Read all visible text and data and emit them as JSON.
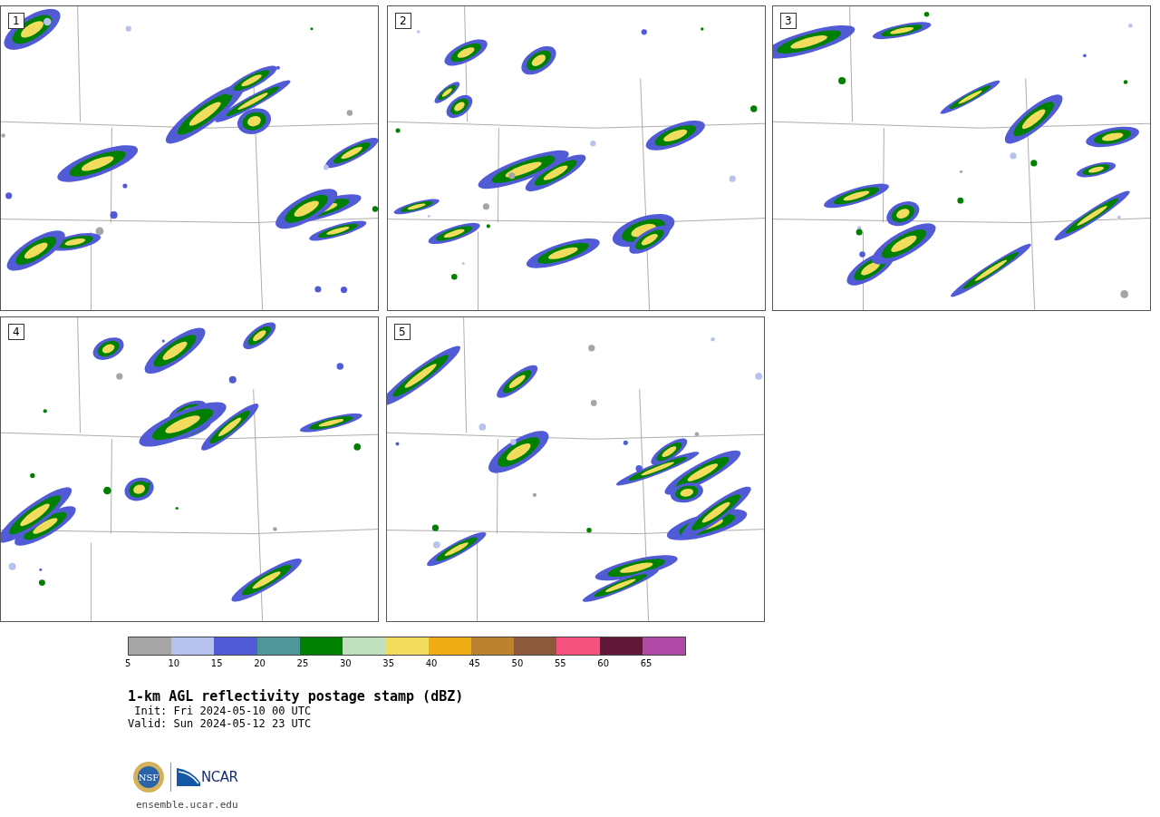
{
  "panels": [
    {
      "label": "1"
    },
    {
      "label": "2"
    },
    {
      "label": "3"
    },
    {
      "label": "4"
    },
    {
      "label": "5"
    }
  ],
  "colorbar": {
    "bins": [
      {
        "label": "5",
        "color": "#a5a5a5"
      },
      {
        "label": "10",
        "color": "#b7c3ee"
      },
      {
        "label": "15",
        "color": "#525bd6"
      },
      {
        "label": "20",
        "color": "#4f9699"
      },
      {
        "label": "25",
        "color": "#008000"
      },
      {
        "label": "30",
        "color": "#bfdfbf"
      },
      {
        "label": "35",
        "color": "#f1dc5e"
      },
      {
        "label": "40",
        "color": "#f0ac15"
      },
      {
        "label": "45",
        "color": "#bb8330"
      },
      {
        "label": "50",
        "color": "#8b5a3c"
      },
      {
        "label": "55",
        "color": "#f65280"
      },
      {
        "label": "60",
        "color": "#601838"
      },
      {
        "label": "65",
        "color": "#ae4aa6"
      }
    ]
  },
  "title": "1-km AGL reflectivity postage stamp (dBZ)",
  "init": " Init: Fri 2024-05-10 00 UTC",
  "valid": "Valid: Sun 2024-05-12 23 UTC",
  "logos": [
    {
      "kind": "nsf",
      "text": "NSF"
    },
    {
      "kind": "ncar",
      "text": "NCAR"
    }
  ],
  "url": "ensemble.ucar.edu"
}
